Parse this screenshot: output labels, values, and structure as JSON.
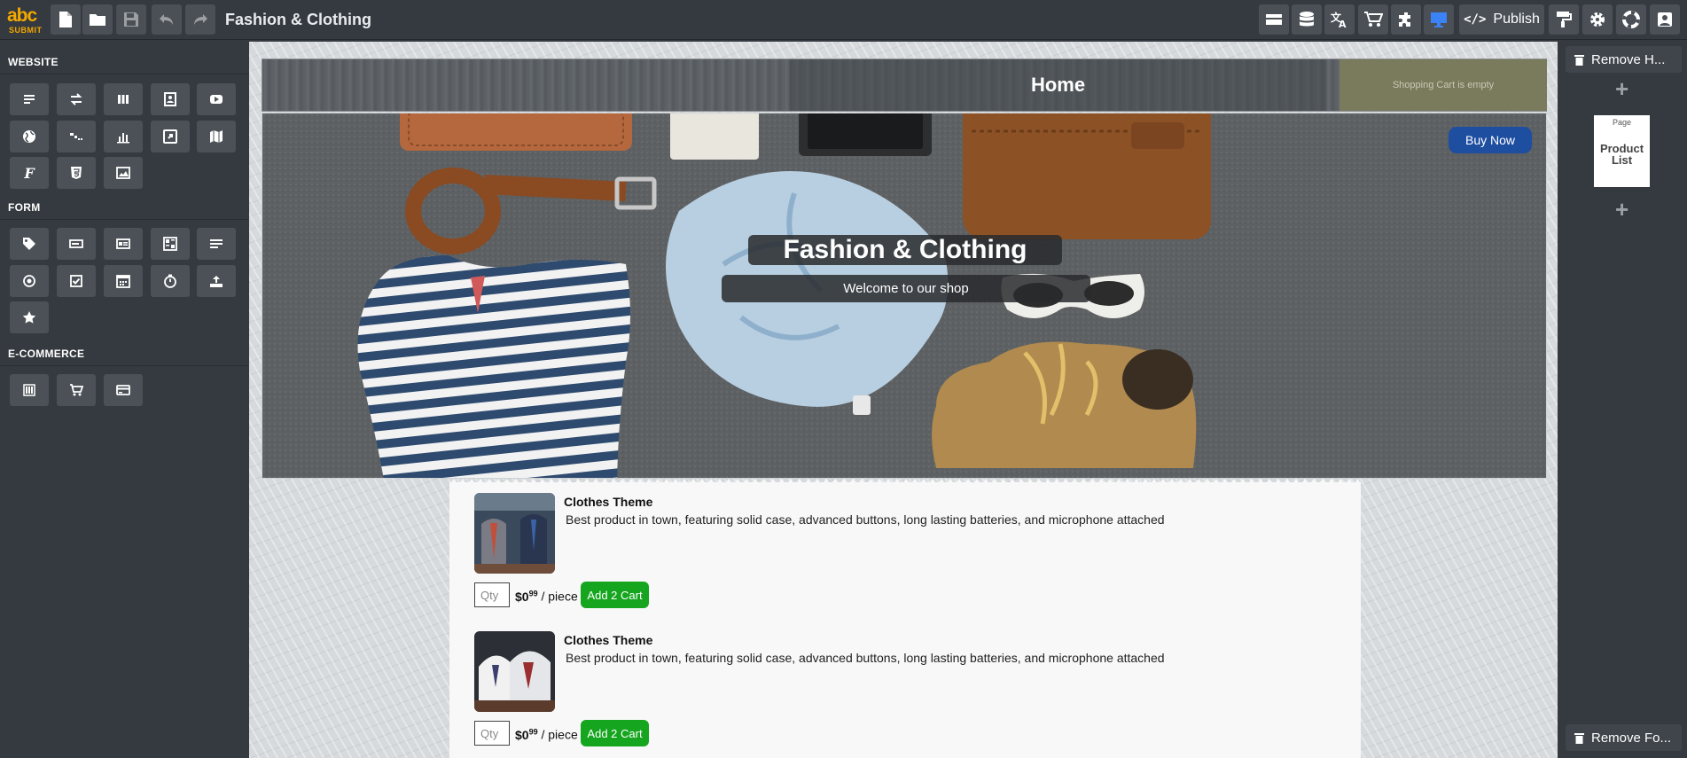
{
  "app": {
    "logo_top": "abc",
    "logo_bottom": "SUBMIT",
    "title": "Fashion & Clothing"
  },
  "toolbar": {
    "left_icons": [
      "new-file-icon",
      "open-folder-icon",
      "save-icon",
      "undo-icon",
      "redo-icon"
    ],
    "right_icons": [
      "layout-icon",
      "database-icon",
      "translate-icon",
      "cart-icon",
      "plugin-icon",
      "desktop-icon"
    ],
    "publish_code": "</>",
    "publish_label": "Publish",
    "after_publish_icons": [
      "paint-roller-icon",
      "gear-icon",
      "help-icon",
      "user-icon"
    ]
  },
  "sidebar": {
    "sections": {
      "website": "WEBSITE",
      "form": "FORM",
      "ecommerce": "E-COMMERCE"
    },
    "website_widgets": [
      "text-icon",
      "swap-icon",
      "columns-icon",
      "contact-icon",
      "youtube-icon",
      "globe-icon",
      "steps-icon",
      "bar-chart-icon",
      "embed-icon",
      "map-icon",
      "font-icon",
      "html5-icon",
      "image-icon"
    ],
    "font_glyph": "F",
    "form_widgets": [
      "tag-icon",
      "input-icon",
      "card-icon",
      "table-icon",
      "textarea-icon",
      "radio-icon",
      "checkbox-icon",
      "calendar-icon",
      "timer-icon",
      "upload-icon",
      "star-icon"
    ],
    "ecommerce_widgets": [
      "product-list-icon",
      "shopping-cart-icon",
      "credit-card-icon"
    ]
  },
  "page": {
    "nav_home": "Home",
    "cart_status": "Shopping Cart is empty",
    "hero_title": "Fashion & Clothing",
    "hero_subtitle": "Welcome to our shop",
    "buy_now": "Buy Now",
    "products": [
      {
        "name": "Clothes Theme",
        "description": "Best product in town, featuring solid case, advanced buttons, long lasting batteries, and microphone attached",
        "qty_placeholder": "Qty",
        "price_main": "$0",
        "price_cents": "99",
        "price_unit": "/ piece",
        "add_label": "Add 2 Cart"
      },
      {
        "name": "Clothes Theme",
        "description": "Best product in town, featuring solid case, advanced buttons, long lasting batteries, and microphone attached",
        "qty_placeholder": "Qty",
        "price_main": "$0",
        "price_cents": "99",
        "price_unit": "/ piece",
        "add_label": "Add 2 Cart"
      }
    ]
  },
  "rightpanel": {
    "remove_header": "Remove H...",
    "remove_footer": "Remove Fo...",
    "plus": "+",
    "page_label": "Page",
    "page_name": "Product List"
  },
  "colors": {
    "accent_blue": "#1e4ea0",
    "add_green": "#15a51e",
    "brand_orange": "#f5a800"
  }
}
